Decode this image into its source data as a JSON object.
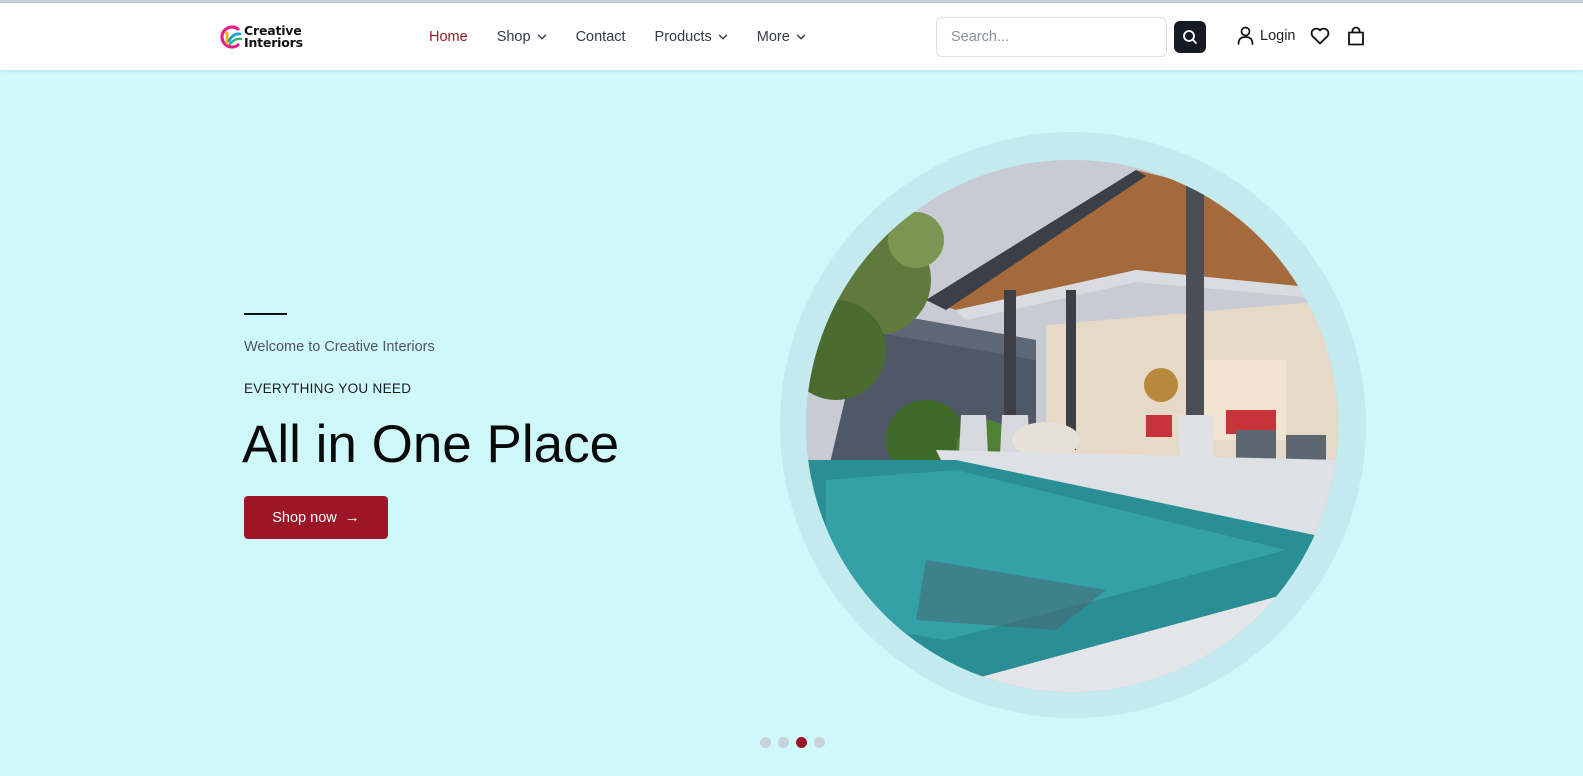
{
  "brand": {
    "line1": "Creative",
    "line2": "Interiors"
  },
  "nav": {
    "items": [
      {
        "label": "Home",
        "active": true,
        "dropdown": false
      },
      {
        "label": "Shop",
        "active": false,
        "dropdown": true
      },
      {
        "label": "Contact",
        "active": false,
        "dropdown": false
      },
      {
        "label": "Products",
        "active": false,
        "dropdown": true
      },
      {
        "label": "More",
        "active": false,
        "dropdown": true
      }
    ]
  },
  "search": {
    "placeholder": "Search...",
    "value": ""
  },
  "account": {
    "login_label": "Login"
  },
  "icons": {
    "search": "search-icon",
    "user": "user-icon",
    "wishlist": "heart-icon",
    "cart": "shopping-bag-icon",
    "chevron": "chevron-down-icon",
    "arrow": "arrow-right-icon"
  },
  "hero": {
    "welcome": "Welcome to Creative Interiors",
    "eyebrow": "EVERYTHING YOU NEED",
    "headline": "All in One Place",
    "cta_label": "Shop now",
    "cta_arrow": "→",
    "image_description": "villa-pool-patio"
  },
  "carousel": {
    "slide_count": 4,
    "active_index": 2
  },
  "colors": {
    "accent": "#9c1628",
    "hero_background": "#cff8fb",
    "ring": "#c3eaee",
    "search_button": "#151a24"
  }
}
